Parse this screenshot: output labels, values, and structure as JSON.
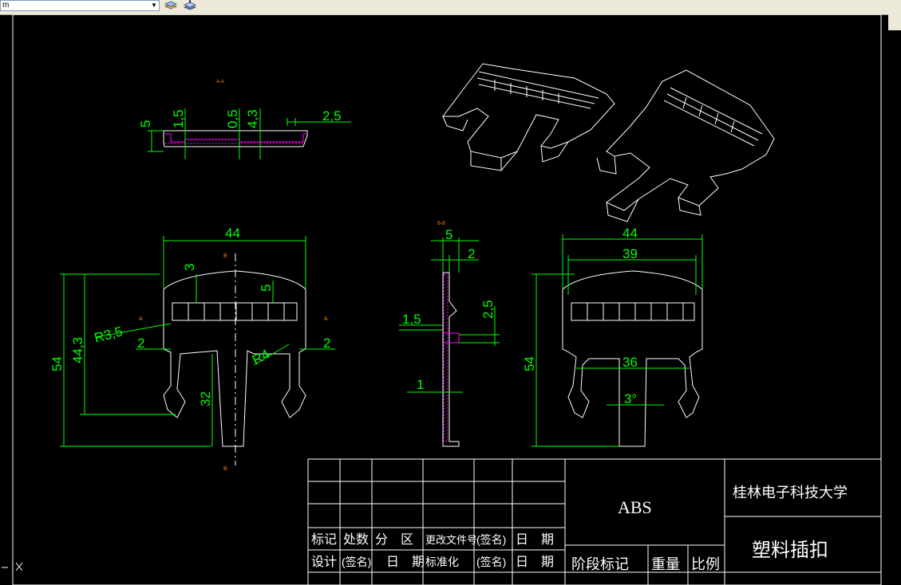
{
  "toolbar": {
    "layer_value": "m",
    "dropdown_icon": "chevron-down-icon",
    "layer_manager_icon": "layers-icon",
    "layer_states_icon": "layer-states-icon"
  },
  "colors": {
    "canvas": "#000000",
    "geometry": "#ffffff",
    "dimension": "#00ff00",
    "hatch": "#ff00ff",
    "centerline": "#ffffff",
    "section_label": "#ff8000"
  },
  "drawing": {
    "section_a_title": "A-A",
    "section_b_title": "B-B",
    "top_dims": [
      "5",
      "1,5",
      "0,5",
      "4,3",
      "2,5"
    ],
    "front_dims": [
      "44",
      "3",
      "5",
      "44,3",
      "54",
      "R3,5",
      "2",
      "2",
      "R4",
      "32"
    ],
    "side_dims": [
      "5",
      "2",
      "2,5",
      "1,5",
      "1"
    ],
    "right_dims": [
      "44",
      "39",
      "54",
      "36",
      "3°"
    ],
    "labels": {
      "b_top": "B",
      "b_bottom": "B",
      "a_left": "A",
      "a_right": "A"
    }
  },
  "title_block": {
    "material": "ABS",
    "school": "桂林电子科技大学",
    "part_name": "塑料插扣",
    "row_labels_1": [
      "标记",
      "处数",
      "分　区",
      "更改文件号",
      "(签名)",
      "日　期"
    ],
    "row_labels_2": [
      "设计",
      "(签名)",
      "日　期",
      "标准化",
      "(签名)",
      "日　期"
    ],
    "stage_label": "阶段标记",
    "weight_label": "重量",
    "scale_label": "比例"
  }
}
